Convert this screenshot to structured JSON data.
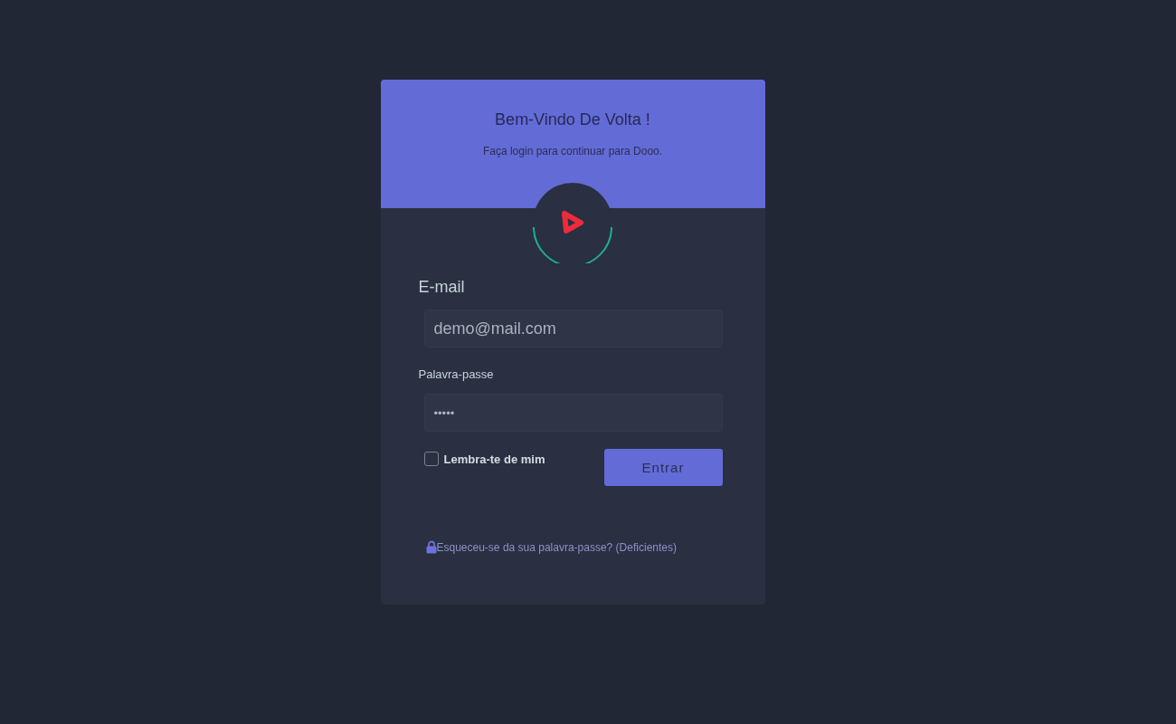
{
  "header": {
    "title": "Bem-Vindo De Volta !",
    "subtitle": "Faça login para continuar para Dooo."
  },
  "form": {
    "email": {
      "label": "E-mail",
      "value": "demo@mail.com"
    },
    "password": {
      "label": "Palavra-passe",
      "value": "•••••"
    },
    "remember": {
      "label": "Lembra-te de mim",
      "checked": false
    },
    "submit": "Entrar"
  },
  "forgot_link": "Esqueceu-se da sua palavra-passe? (Deficientes)"
}
